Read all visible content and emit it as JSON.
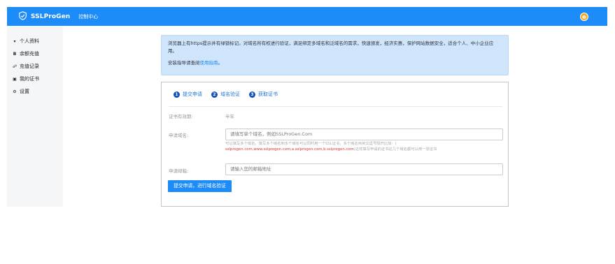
{
  "header": {
    "brand": "SSLProGen",
    "nav_label": "控制中心",
    "avatar_icon": "user-avatar-icon"
  },
  "sidebar": {
    "items": [
      {
        "icon": "user-icon",
        "glyph": "👤",
        "label": "个人资料"
      },
      {
        "icon": "balance-icon",
        "glyph": "B",
        "label": "余额充值"
      },
      {
        "icon": "link-icon",
        "glyph": "🔗",
        "label": "充值记录"
      },
      {
        "icon": "certificate-icon",
        "glyph": "🖫",
        "label": "我的证书"
      },
      {
        "icon": "gear-icon",
        "glyph": "⚙",
        "label": "设置"
      }
    ]
  },
  "notice": {
    "text": "浏览器上有https提示并有绿锁标记。对域名所有权进行验证，满足绑定多域名和泛域名的需求，快速颁发，经济实惠，保护网站数据安全，适合个人、中小企业应用。",
    "guide_prefix": "安装指导请查阅",
    "guide_link": "使用指南",
    "guide_suffix": "。"
  },
  "steps": [
    {
      "num": "1",
      "label": "提交申请"
    },
    {
      "num": "2",
      "label": "域名验证"
    },
    {
      "num": "3",
      "label": "获取证书"
    }
  ],
  "form": {
    "validity_label": "证书有效期:",
    "validity_value": "半年",
    "domain_label": "申请域名:",
    "domain_placeholder": "请填写单个域名，例如SSLProGen.Com",
    "domain_hint": "可以填写多个域名，填写多个域名到多个域名可以同时用一个SSL证书，多个域名用英文逗号隔开比如：(",
    "domain_hint_example": "sslprogen.com,www.sslprogen.com,a.sslprogen.com,b.sslprogen.com",
    "domain_hint_suffix": ")这样填写申请的证书这几个域名都可以用一张证书",
    "email_label": "申请邮箱:",
    "email_placeholder": "请输入您的邮箱地址",
    "submit_label": "提交申请，进行域名验证"
  },
  "colors": {
    "accent": "#1d8cf8",
    "notice_bg": "#cfe5fb",
    "step_badge": "#1451b8",
    "hint_red": "#d33333"
  }
}
